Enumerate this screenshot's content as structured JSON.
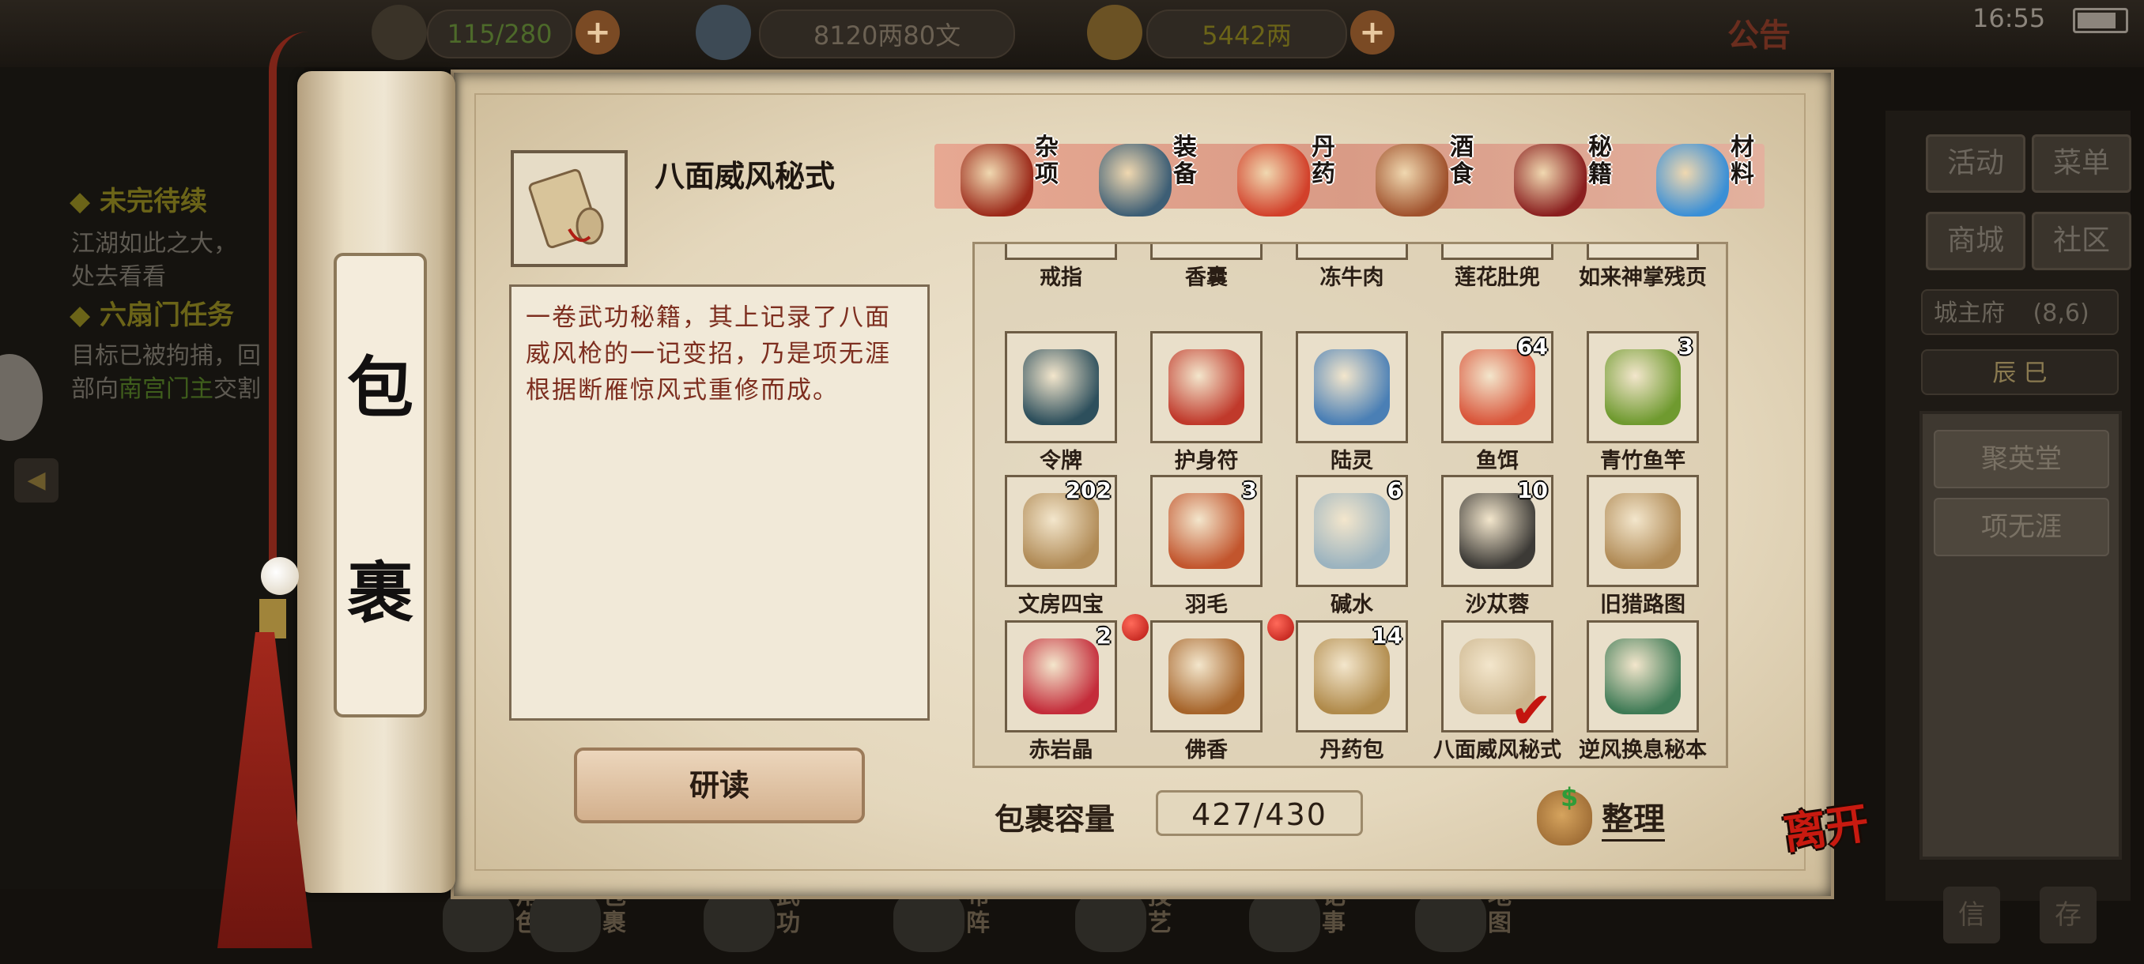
{
  "top_bar": {
    "resource1": "115/280",
    "resource2": "8120两80文",
    "resource3": "5442两",
    "notice": "公告",
    "time": "16:55"
  },
  "quests": {
    "section1_title": "◆ 未完待续",
    "section1_text1": "江湖如此之大，",
    "section1_text2": "处去看看",
    "section2_title": "◆ 六扇门任务",
    "section2_text1": "目标已被拘捕，回",
    "section2_text2a": "部向",
    "section2_text2b": "南宫门主",
    "section2_text2c": "交割"
  },
  "right_menu": {
    "btn_activity": "活动",
    "btn_menu": "菜单",
    "btn_shop": "商城",
    "btn_community": "社区",
    "location": "城主府",
    "coords": "(8,6)",
    "time_label": "辰 巳",
    "list_item1": "聚英堂",
    "list_item2": "项无涯"
  },
  "bottom_nav": [
    {
      "label": "角色"
    },
    {
      "label": "包裹"
    },
    {
      "label": "武功"
    },
    {
      "label": "布阵"
    },
    {
      "label": "技艺"
    },
    {
      "label": "记事"
    },
    {
      "label": "地图"
    }
  ],
  "bottom_right": {
    "btn1": "信",
    "btn2": "存"
  },
  "scroll": {
    "char1": "包",
    "char2": "裹"
  },
  "selected_item": {
    "name": "八面威风秘式",
    "description": "一卷武功秘籍，其上记录了八面威风枪的一记变招，乃是项无涯根据断雁惊风式重修而成。",
    "study_label": "研读"
  },
  "categories": [
    {
      "label": "杂项",
      "color": "#9c2a1a"
    },
    {
      "label": "装备",
      "color": "#3d5e75"
    },
    {
      "label": "丹药",
      "color": "#d2402a"
    },
    {
      "label": "酒食",
      "color": "#a0522d"
    },
    {
      "label": "秘籍",
      "color": "#8a1f1f"
    },
    {
      "label": "材料",
      "color": "#3a8fd6"
    }
  ],
  "inventory": {
    "row0": [
      {
        "name": "戒指",
        "count": "",
        "icon": "ring-icon",
        "color": "#8a5a2b"
      },
      {
        "name": "香囊",
        "count": "",
        "icon": "sachet-icon",
        "color": "#c0392b"
      },
      {
        "name": "冻牛肉",
        "count": "",
        "icon": "beef-icon",
        "color": "#d98a8a"
      },
      {
        "name": "莲花肚兜",
        "count": "",
        "icon": "bib-icon",
        "color": "#c39bd3"
      },
      {
        "name": "如来神掌残页",
        "count": "",
        "icon": "page-icon",
        "color": "#b5894a"
      }
    ],
    "row1": [
      {
        "name": "令牌",
        "count": "",
        "icon": "token-icon",
        "color": "#2d4f5c"
      },
      {
        "name": "护身符",
        "count": "",
        "icon": "amulet-icon",
        "color": "#c0392b"
      },
      {
        "name": "陆灵",
        "count": "",
        "icon": "crossed-blades-icon",
        "color": "#4a7fb5"
      },
      {
        "name": "鱼饵",
        "count": "64",
        "icon": "worm-icon",
        "color": "#d9553a"
      },
      {
        "name": "青竹鱼竿",
        "count": "3",
        "icon": "fishing-rod-icon",
        "color": "#6f9a2f"
      }
    ],
    "row2": [
      {
        "name": "文房四宝",
        "count": "202",
        "icon": "stationery-icon",
        "color": "#b08a55"
      },
      {
        "name": "羽毛",
        "count": "3",
        "icon": "feather-icon",
        "color": "#c2552d"
      },
      {
        "name": "碱水",
        "count": "6",
        "icon": "bowl-icon",
        "color": "#9bb3bf"
      },
      {
        "name": "沙苁蓉",
        "count": "10",
        "icon": "herb-icon",
        "color": "#3c3a36"
      },
      {
        "name": "旧猎路图",
        "count": "",
        "icon": "map-icon",
        "color": "#b08a55"
      }
    ],
    "row3": [
      {
        "name": "赤岩晶",
        "count": "2",
        "icon": "crystal-icon",
        "color": "#c42c3a",
        "dot": false,
        "checked": false
      },
      {
        "name": "佛香",
        "count": "",
        "icon": "incense-icon",
        "color": "#a6642a",
        "dot": true,
        "checked": false
      },
      {
        "name": "丹药包",
        "count": "14",
        "icon": "pouch-icon",
        "color": "#b08a4a",
        "dot": true,
        "checked": false
      },
      {
        "name": "八面威风秘式",
        "count": "",
        "icon": "scroll-icon",
        "color": "#cbb48c",
        "dot": false,
        "checked": true
      },
      {
        "name": "逆风换息秘本",
        "count": "",
        "icon": "book-bundle-icon",
        "color": "#3e7a55",
        "dot": false,
        "checked": false
      }
    ]
  },
  "capacity": {
    "label": "包裹容量",
    "value": "427/430"
  },
  "sort_label": "整理",
  "leave_label": "离开"
}
